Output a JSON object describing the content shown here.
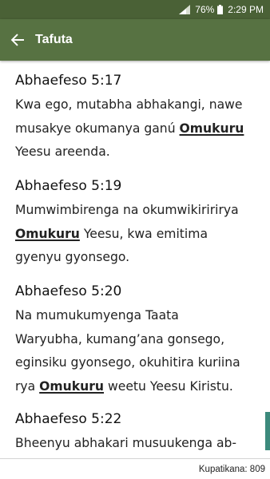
{
  "status_bar": {
    "battery": "76%",
    "time": "2:29 PM"
  },
  "app_bar": {
    "title": "Tafuta"
  },
  "results": [
    {
      "reference": "Abhaefeso 5:17",
      "lines": [
        [
          "Kwa ego, mutabha abhakangi, nawe"
        ],
        [
          "musakye okumanya ganú ",
          {
            "hl": "Omukuru"
          }
        ],
        [
          "Yeesu areenda."
        ]
      ]
    },
    {
      "reference": "Abhaefeso 5:19",
      "lines": [
        [
          "Mumwimbirenga na okumwikiririrya"
        ],
        [
          {
            "hl": "Omukuru"
          },
          " Yeesu, kwa emitima"
        ],
        [
          "gyenyu gyonsego."
        ]
      ]
    },
    {
      "reference": "Abhaefeso 5:20",
      "lines": [
        [
          "Na mumukumyenga Taata"
        ],
        [
          "Waryubha, kumang’ana gonsego,"
        ],
        [
          "eginsiku gyonsego, okuhitira kuriina"
        ],
        [
          "rya ",
          {
            "hl": "Omukuru"
          },
          " weetu Yeesu Kiristu."
        ]
      ]
    },
    {
      "reference": "Abhaefeso 5:22",
      "lines": [
        [
          "Bheenyu abhakari musuukenga ab-"
        ]
      ]
    }
  ],
  "footer": {
    "count_label": "Kupatikana: 809"
  },
  "colors": {
    "status_bar": "#4a6136",
    "app_bar": "#577242",
    "scroll_thumb": "#3c8a7c"
  }
}
